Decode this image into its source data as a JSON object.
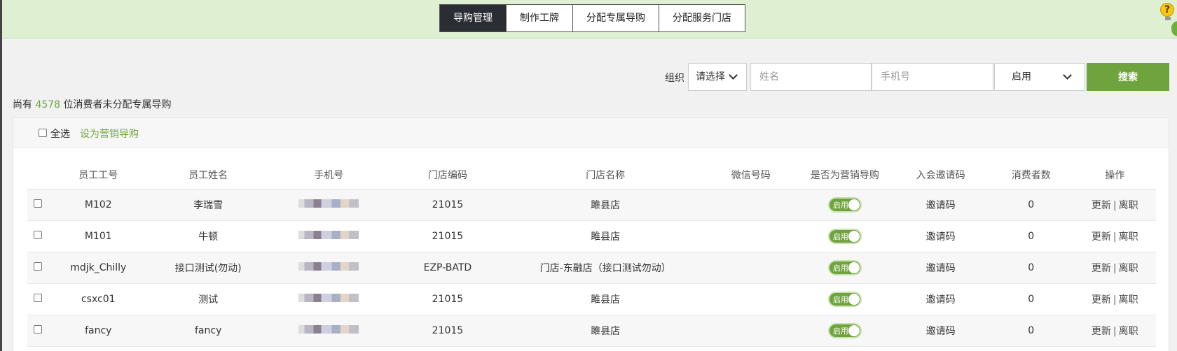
{
  "tabs": [
    {
      "label": "导购管理",
      "active": true
    },
    {
      "label": "制作工牌",
      "active": false
    },
    {
      "label": "分配专属导购",
      "active": false
    },
    {
      "label": "分配服务门店",
      "active": false
    }
  ],
  "help_icon": "question-bulb-icon",
  "filters": {
    "org_label": "组织",
    "org_select": "请选择",
    "name_placeholder": "姓名",
    "phone_placeholder": "手机号",
    "status_select": "启用",
    "search_label": "搜索"
  },
  "notice": {
    "prefix": "尚有",
    "count": "4578",
    "suffix": "位消费者未分配专属导购"
  },
  "toolbar": {
    "select_all": "全选",
    "set_marketing_guide": "设为营销导购"
  },
  "table": {
    "headers": [
      "员工工号",
      "员工姓名",
      "手机号",
      "门店编码",
      "门店名称",
      "微信号码",
      "是否为营销导购",
      "入会邀请码",
      "消费者数",
      "操作"
    ],
    "rows": [
      {
        "id": "M102",
        "name": "李瑞雪",
        "store_code": "21015",
        "store_name": "雎县店",
        "wechat": "",
        "toggle": "启用",
        "invite": "邀请码",
        "consumers": "0",
        "update": "更新",
        "sep": "|",
        "resign": "离职"
      },
      {
        "id": "M101",
        "name": "牛顿",
        "store_code": "21015",
        "store_name": "雎县店",
        "wechat": "",
        "toggle": "启用",
        "invite": "邀请码",
        "consumers": "0",
        "update": "更新",
        "sep": "|",
        "resign": "离职"
      },
      {
        "id": "mdjk_Chilly",
        "name": "接口测试(勿动)",
        "store_code": "EZP-BATD",
        "store_name": "门店-东融店（接口测试勿动）",
        "wechat": "",
        "toggle": "启用",
        "invite": "邀请码",
        "consumers": "0",
        "update": "更新",
        "sep": "|",
        "resign": "离职"
      },
      {
        "id": "csxc01",
        "name": "测试",
        "store_code": "21015",
        "store_name": "雎县店",
        "wechat": "",
        "toggle": "启用",
        "invite": "邀请码",
        "consumers": "0",
        "update": "更新",
        "sep": "|",
        "resign": "离职"
      },
      {
        "id": "fancy",
        "name": "fancy",
        "store_code": "21015",
        "store_name": "雎县店",
        "wechat": "",
        "toggle": "启用",
        "invite": "邀请码",
        "consumers": "0",
        "update": "更新",
        "sep": "|",
        "resign": "离职"
      }
    ]
  },
  "colors": {
    "accent": "#6fa33e",
    "header_bg": "#dff0d2",
    "active_tab": "#2a2d33"
  }
}
